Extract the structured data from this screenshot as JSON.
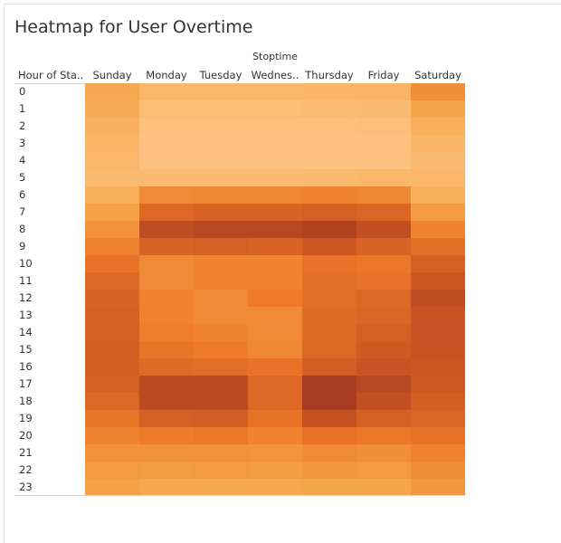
{
  "title": "Heatmap for User Overtime",
  "chart_data": {
    "type": "heatmap",
    "title": "Heatmap for User Overtime",
    "column_group_label": "Stoptime",
    "row_header_label": "Hour of Sta..",
    "columns": [
      "Sunday",
      "Monday",
      "Tuesday",
      "Wednes..",
      "Thursday",
      "Friday",
      "Saturday"
    ],
    "rows": [
      "0",
      "1",
      "2",
      "3",
      "4",
      "5",
      "6",
      "7",
      "8",
      "9",
      "10",
      "11",
      "12",
      "13",
      "14",
      "15",
      "16",
      "17",
      "18",
      "19",
      "20",
      "21",
      "22",
      "23"
    ],
    "values": [
      [
        0.22,
        0.12,
        0.12,
        0.12,
        0.13,
        0.14,
        0.38
      ],
      [
        0.2,
        0.08,
        0.08,
        0.08,
        0.09,
        0.1,
        0.24
      ],
      [
        0.17,
        0.06,
        0.06,
        0.06,
        0.06,
        0.07,
        0.18
      ],
      [
        0.14,
        0.05,
        0.05,
        0.05,
        0.05,
        0.05,
        0.14
      ],
      [
        0.12,
        0.05,
        0.05,
        0.05,
        0.05,
        0.05,
        0.1
      ],
      [
        0.1,
        0.1,
        0.1,
        0.1,
        0.11,
        0.12,
        0.12
      ],
      [
        0.18,
        0.4,
        0.42,
        0.42,
        0.44,
        0.42,
        0.18
      ],
      [
        0.26,
        0.64,
        0.68,
        0.68,
        0.7,
        0.66,
        0.3
      ],
      [
        0.36,
        0.86,
        0.9,
        0.9,
        0.95,
        0.84,
        0.44
      ],
      [
        0.46,
        0.68,
        0.7,
        0.68,
        0.78,
        0.68,
        0.58
      ],
      [
        0.56,
        0.4,
        0.44,
        0.44,
        0.56,
        0.52,
        0.7
      ],
      [
        0.64,
        0.4,
        0.44,
        0.44,
        0.58,
        0.56,
        0.78
      ],
      [
        0.68,
        0.46,
        0.4,
        0.5,
        0.6,
        0.64,
        0.86
      ],
      [
        0.7,
        0.46,
        0.4,
        0.4,
        0.62,
        0.66,
        0.8
      ],
      [
        0.7,
        0.48,
        0.44,
        0.4,
        0.62,
        0.7,
        0.8
      ],
      [
        0.72,
        0.54,
        0.5,
        0.42,
        0.64,
        0.74,
        0.8
      ],
      [
        0.72,
        0.62,
        0.6,
        0.56,
        0.72,
        0.8,
        0.78
      ],
      [
        0.7,
        0.88,
        0.88,
        0.64,
        1.0,
        0.9,
        0.76
      ],
      [
        0.64,
        0.88,
        0.88,
        0.64,
        1.0,
        0.84,
        0.72
      ],
      [
        0.54,
        0.7,
        0.72,
        0.56,
        0.82,
        0.7,
        0.66
      ],
      [
        0.44,
        0.5,
        0.52,
        0.44,
        0.56,
        0.52,
        0.56
      ],
      [
        0.36,
        0.36,
        0.36,
        0.34,
        0.4,
        0.38,
        0.46
      ],
      [
        0.3,
        0.28,
        0.3,
        0.28,
        0.32,
        0.3,
        0.38
      ],
      [
        0.26,
        0.22,
        0.22,
        0.22,
        0.24,
        0.24,
        0.32
      ]
    ],
    "color_scale": [
      "#ffc98e",
      "#f5a347",
      "#ee7a2a",
      "#cf5a22",
      "#a83c20"
    ]
  }
}
